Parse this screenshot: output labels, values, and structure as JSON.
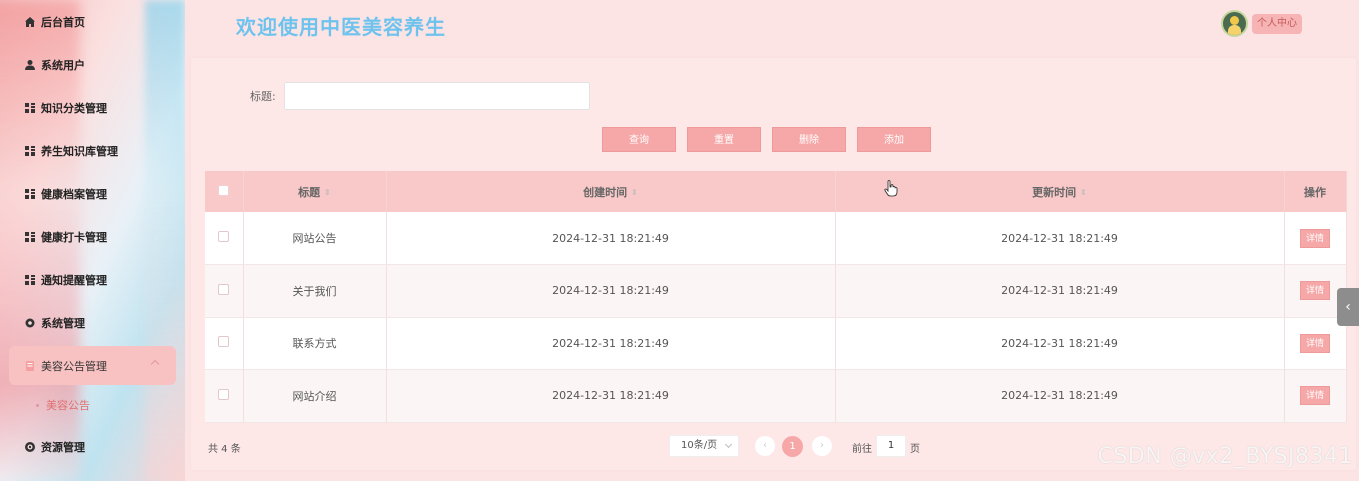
{
  "header": {
    "title": "欢迎使用中医美容养生",
    "user_button": "个人中心"
  },
  "sidebar": {
    "items": [
      {
        "label": "后台首页",
        "icon": "home-icon"
      },
      {
        "label": "系统用户",
        "icon": "user-icon"
      },
      {
        "label": "知识分类管理",
        "icon": "grid-icon"
      },
      {
        "label": "养生知识库管理",
        "icon": "grid-icon"
      },
      {
        "label": "健康档案管理",
        "icon": "grid-icon"
      },
      {
        "label": "健康打卡管理",
        "icon": "grid-icon"
      },
      {
        "label": "通知提醒管理",
        "icon": "grid-icon"
      },
      {
        "label": "系统管理",
        "icon": "gear-icon"
      },
      {
        "label": "美容公告管理",
        "icon": "document-icon",
        "active": true
      },
      {
        "label": "资源管理",
        "icon": "target-icon"
      }
    ],
    "sub_item": "美容公告"
  },
  "search": {
    "label": "标题:",
    "value": ""
  },
  "buttons": {
    "query": "查询",
    "reset": "重置",
    "delete": "删除",
    "add": "添加"
  },
  "table": {
    "headers": {
      "title": "标题",
      "created": "创建时间",
      "updated": "更新时间",
      "actions": "操作"
    },
    "rows": [
      {
        "title": "网站公告",
        "created": "2024-12-31 18:21:49",
        "updated": "2024-12-31 18:21:49",
        "action": "详情"
      },
      {
        "title": "关于我们",
        "created": "2024-12-31 18:21:49",
        "updated": "2024-12-31 18:21:49",
        "action": "详情"
      },
      {
        "title": "联系方式",
        "created": "2024-12-31 18:21:49",
        "updated": "2024-12-31 18:21:49",
        "action": "详情"
      },
      {
        "title": "网站介绍",
        "created": "2024-12-31 18:21:49",
        "updated": "2024-12-31 18:21:49",
        "action": "详情"
      }
    ]
  },
  "pagination": {
    "total": "共 4 条",
    "page_size": "10条/页",
    "current_page": "1",
    "goto_prefix": "前往",
    "goto_value": "1",
    "goto_suffix": "页"
  },
  "watermark": "CSDN @vx2_BYSJ8341",
  "colors": {
    "accent": "#f6a8a8",
    "title": "#6ec3ee",
    "background": "#fde4e4"
  }
}
